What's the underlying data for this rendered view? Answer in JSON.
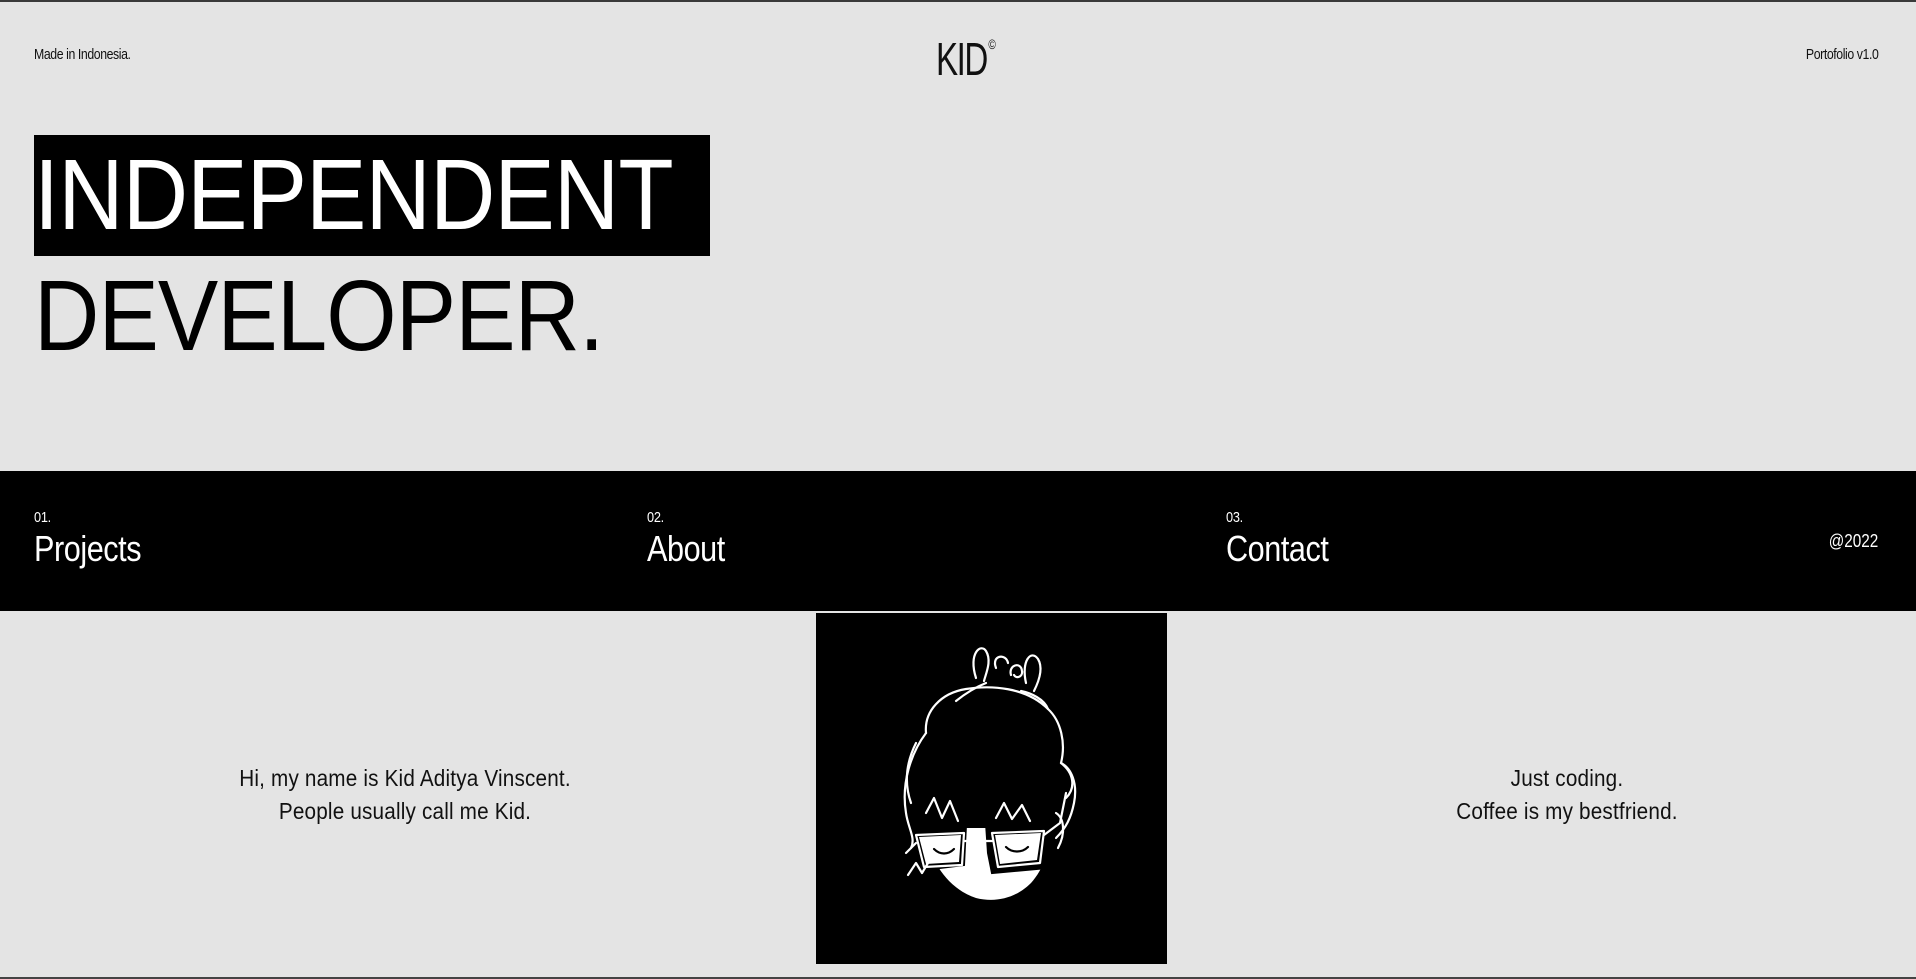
{
  "header": {
    "made_in": "Made in Indonesia.",
    "logo": "KID",
    "logo_mark": "©",
    "version": "Portofolio v1.0"
  },
  "hero": {
    "line1": "INDEPENDENT",
    "line2": "DEVELOPER."
  },
  "nav": {
    "items": [
      {
        "num": "01.",
        "label": "Projects"
      },
      {
        "num": "02.",
        "label": "About"
      },
      {
        "num": "03.",
        "label": "Contact"
      }
    ],
    "year": "@2022"
  },
  "about": {
    "intro_line1": "Hi, my name is Kid Aditya Vinscent.",
    "intro_line2": "People usually call me Kid.",
    "note_line1": "Just coding.",
    "note_line2": "Coffee is my bestfriend."
  },
  "colors": {
    "background": "#e4e4e4",
    "ink": "#000000",
    "inverse": "#ffffff"
  },
  "icons": {
    "avatar": "avatar-illustration"
  }
}
